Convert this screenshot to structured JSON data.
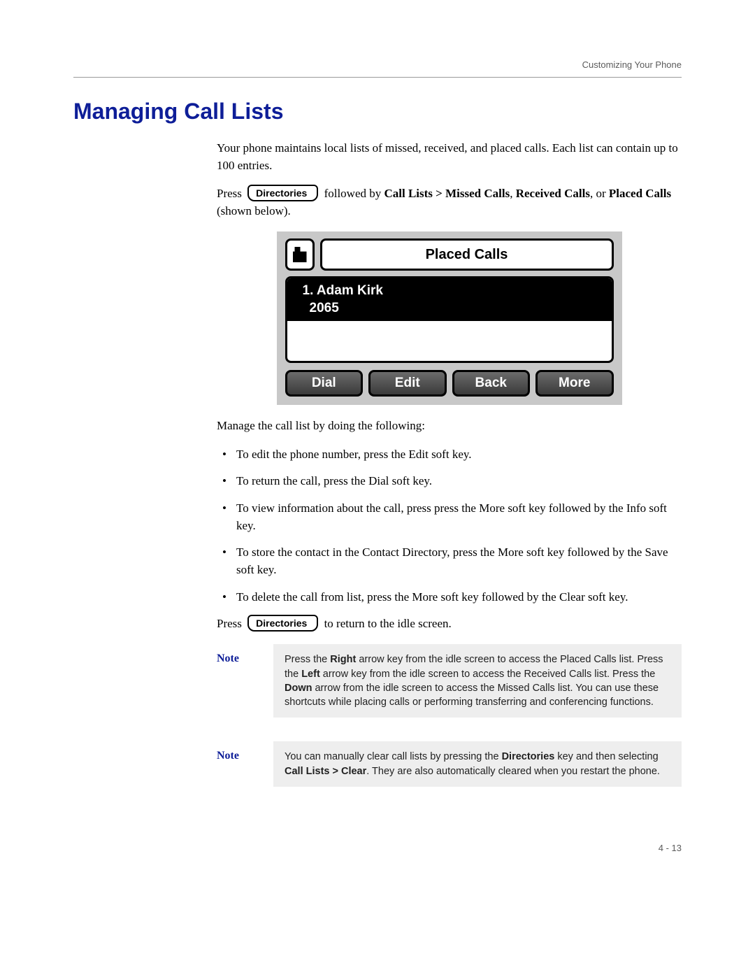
{
  "header": {
    "running": "Customizing Your Phone"
  },
  "title": "Managing Call Lists",
  "intro": "Your phone maintains local lists of missed, received, and placed calls. Each list can contain up to 100 entries.",
  "press1_pre": "Press",
  "press1_post": "followed by ",
  "press1_bold_path": "Call Lists > Missed Calls",
  "press1_mid": ", ",
  "press1_bold_recv": "Received Calls",
  "press1_mid2": ", or ",
  "press1_bold_placed": "Placed Calls",
  "press1_end": " (shown below).",
  "key_label": "Directories",
  "phone": {
    "title": "Placed Calls",
    "entry_name": "1. Adam Kirk",
    "entry_num": "2065",
    "softkeys": [
      "Dial",
      "Edit",
      "Back",
      "More"
    ]
  },
  "manage_intro": "Manage the call list by doing the following:",
  "bullets": [
    {
      "pre": "To edit the phone number, press the ",
      "b": "Edit",
      "post": " soft key."
    },
    {
      "pre": "To return the call, press the ",
      "b": "Dial",
      "post": " soft key."
    },
    {
      "pre": "To view information about the call, press press the ",
      "b": "More",
      "post": " soft key followed by the ",
      "b2": "Info",
      "post2": " soft key."
    },
    {
      "pre": "To store the contact in the Contact Directory, press the ",
      "b": "More",
      "post": " soft key followed by the ",
      "b2": "Save",
      "post2": " soft key."
    },
    {
      "pre": "To delete the call from list, press the ",
      "b": "More",
      "post": " soft key followed by the ",
      "b2": "Clear",
      "post2": " soft key."
    }
  ],
  "press2_pre": "Press",
  "press2_post": "to return to the idle screen.",
  "notes": [
    {
      "label": "Note",
      "lines": [
        {
          "pre": "Press the ",
          "b": "Right",
          "post": " arrow key from the idle screen to access the Placed Calls list."
        },
        {
          "pre": "Press the ",
          "b": "Left",
          "post": " arrow key from the idle screen to access the Received Calls list."
        },
        {
          "pre": "Press the ",
          "b": "Down",
          "post": " arrow from the idle screen to access the Missed Calls list."
        },
        {
          "plain": "You can use these shortcuts while placing calls or performing transferring and conferencing functions."
        }
      ]
    },
    {
      "label": "Note",
      "lines": [
        {
          "pre": "You can manually clear call lists by pressing the ",
          "b": "Directories",
          "post": " key and then selecting "
        },
        {
          "b": "Call Lists > Clear",
          "post": ". They are also automatically cleared when you restart the phone."
        }
      ]
    }
  ],
  "page_number": "4 - 13"
}
